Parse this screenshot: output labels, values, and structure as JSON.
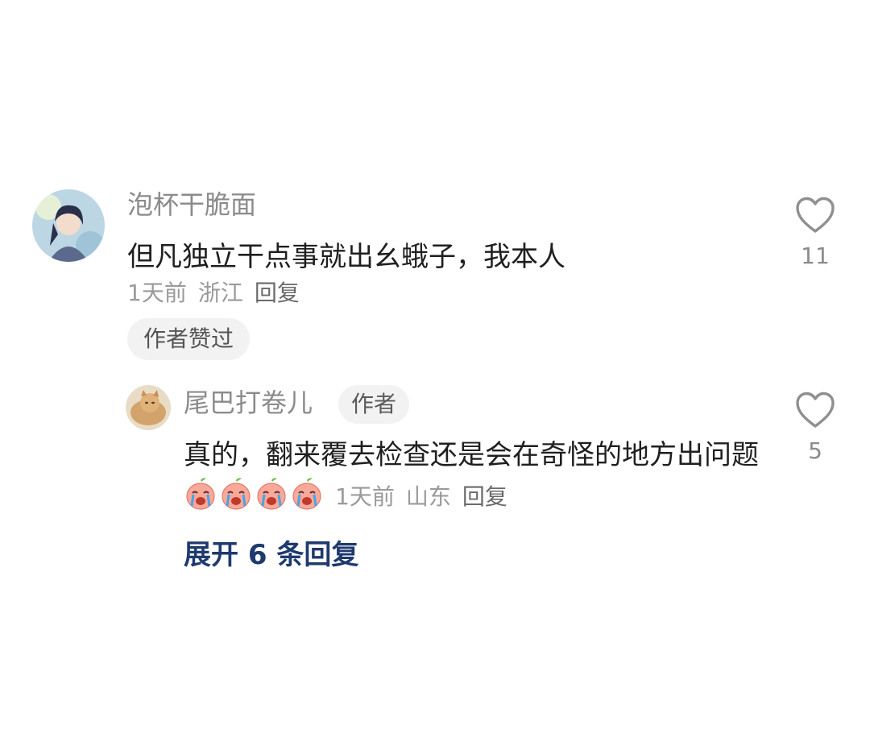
{
  "comment": {
    "username": "泡杯干脆面",
    "text": "但凡独立干点事就出幺蛾子，我本人",
    "time": "1天前",
    "location": "浙江",
    "reply_label": "回复",
    "liked_badge": "作者赞过",
    "like_count": "11"
  },
  "reply": {
    "username": "尾巴打卷儿",
    "author_tag": "作者",
    "text": "真的，翻来覆去检查还是会在奇怪的地方出问题",
    "emoji_count": 4,
    "emoji_name": "crying-peach-emoji",
    "time": "1天前",
    "location": "山东",
    "reply_label": "回复",
    "like_count": "5"
  },
  "expand_replies_label": "展开 6 条回复",
  "colors": {
    "link_blue": "#1e3a6e",
    "muted_text": "#8b8b8b",
    "badge_bg": "#f2f2f2"
  }
}
